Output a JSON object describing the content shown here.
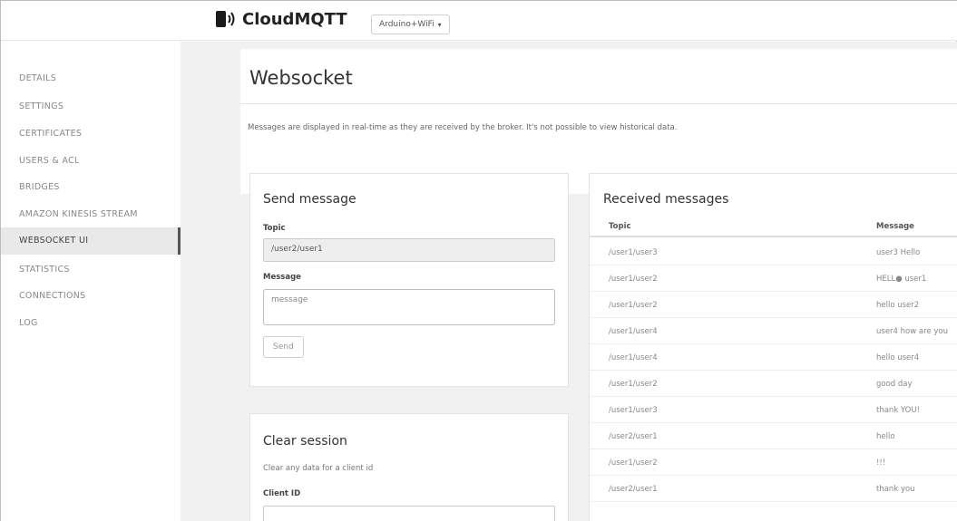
{
  "app": {
    "brand_name": "CloudMQTT",
    "brand_icon": "broker-signal-icon",
    "instance_selector": "Arduino+WiFi",
    "accent_color": "#555555"
  },
  "sidebar": {
    "items": [
      {
        "label": "DETAILS",
        "active": false
      },
      {
        "label": "SETTINGS",
        "active": false
      },
      {
        "label": "CERTIFICATES",
        "active": false
      },
      {
        "label": "USERS & ACL",
        "active": false
      },
      {
        "label": "BRIDGES",
        "active": false
      },
      {
        "label": "AMAZON KINESIS STREAM",
        "active": false
      },
      {
        "label": "WEBSOCKET UI",
        "active": true
      },
      {
        "label": "STATISTICS",
        "active": false
      },
      {
        "label": "CONNECTIONS",
        "active": false
      },
      {
        "label": "LOG",
        "active": false
      }
    ]
  },
  "page": {
    "title": "Websocket",
    "info": "Messages are displayed in real-time as they are received by the broker. It's not possible to view historical data."
  },
  "send_message": {
    "title": "Send message",
    "topic_label": "Topic",
    "topic_value": "/user2/user1",
    "message_label": "Message",
    "message_value": "message",
    "send_label": "Send"
  },
  "clear_session": {
    "title": "Clear session",
    "description": "Clear any data for a client id",
    "client_id_label": "Client ID",
    "client_id_value": ""
  },
  "received": {
    "title": "Received messages",
    "columns": [
      "Topic",
      "Message"
    ],
    "rows": [
      {
        "topic": "/user1/user3",
        "message": "user3 Hello"
      },
      {
        "topic": "/user1/user2",
        "message": "HELL● user1"
      },
      {
        "topic": "/user1/user2",
        "message": "hello user2"
      },
      {
        "topic": "/user1/user4",
        "message": "user4 how are you"
      },
      {
        "topic": "/user1/user4",
        "message": "hello user4"
      },
      {
        "topic": "/user1/user2",
        "message": "good day"
      },
      {
        "topic": "/user1/user3",
        "message": "thank YOU!"
      },
      {
        "topic": "/user2/user1",
        "message": "hello"
      },
      {
        "topic": "/user1/user2",
        "message": "!!!"
      },
      {
        "topic": "/user2/user1",
        "message": "thank you"
      }
    ]
  }
}
